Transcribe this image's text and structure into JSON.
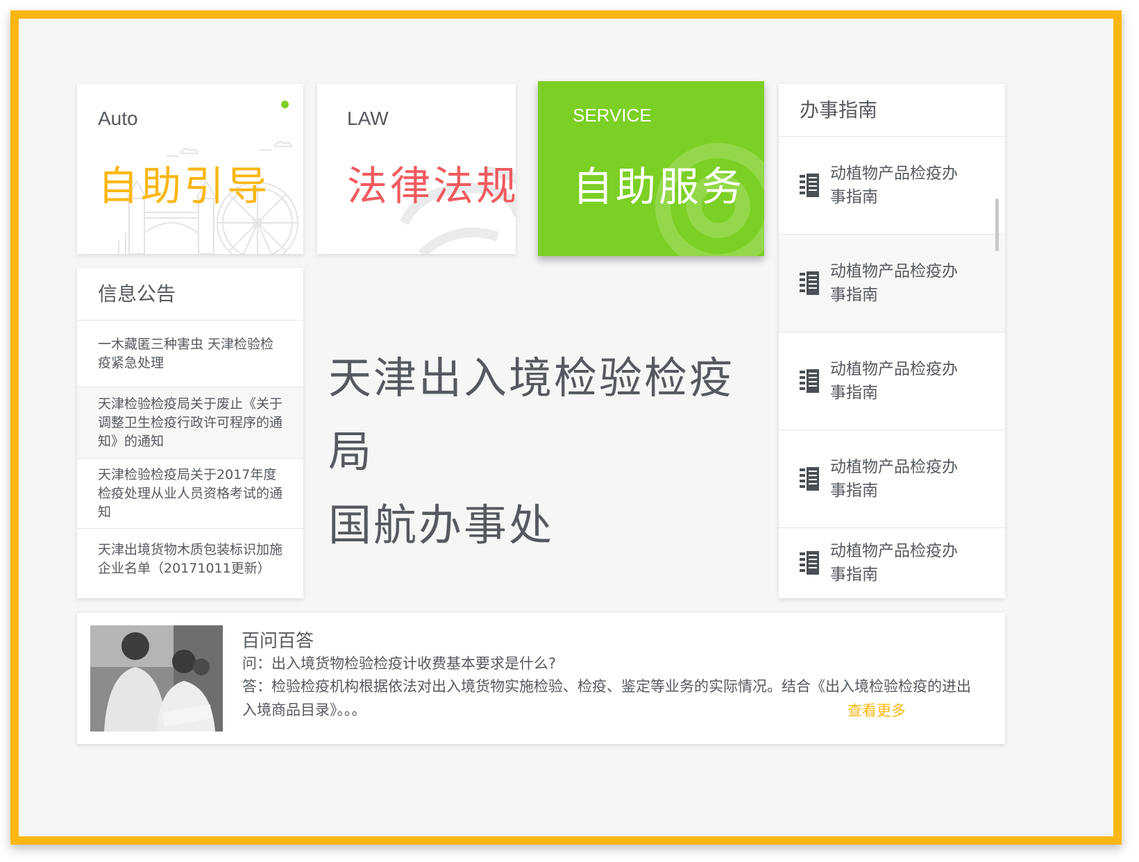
{
  "tiles": {
    "auto": {
      "tag": "Auto",
      "title": "自助引导",
      "title_color": "#fbb611"
    },
    "law": {
      "tag": "LAW",
      "title": "法律法规",
      "title_color": "#f15b5f"
    },
    "service": {
      "tag": "SERVICE",
      "title": "自助服务",
      "bg_color": "#7ccf25"
    }
  },
  "notices": {
    "header": "信息公告",
    "items": [
      "一木藏匿三种害虫 天津检验检疫紧急处理",
      "天津检验检疫局关于废止《关于调整卫生检疫行政许可程序的通知》的通知",
      "天津检验检疫局关于2017年度检疫处理从业人员资格考试的通知",
      "天津出境货物木质包装标识加施企业名单（20171011更新）"
    ]
  },
  "center": {
    "line1": "天津出入境检验检疫局",
    "line2": "国航办事处"
  },
  "guide": {
    "header": "办事指南",
    "icon": "document-list-icon",
    "items": [
      "动植物产品检疫办事指南",
      "动植物产品检疫办事指南",
      "动植物产品检疫办事指南",
      "动植物产品检疫办事指南",
      "动植物产品检疫办事指南"
    ]
  },
  "qa": {
    "title": "百问百答",
    "question": "问：出入境货物检验检疫计收费基本要求是什么?",
    "answer": "答：检验检疫机构根据依法对出入境货物实施检验、检疫、鉴定等业务的实际情况。结合《出入境检验检疫的进出入境商品目录》。。。",
    "more": "查看更多",
    "photo": "inspection-officers-photo"
  },
  "colors": {
    "frame": "#fbb611",
    "accent_green": "#7ccf25",
    "text": "#555a60",
    "link": "#fbb611"
  }
}
